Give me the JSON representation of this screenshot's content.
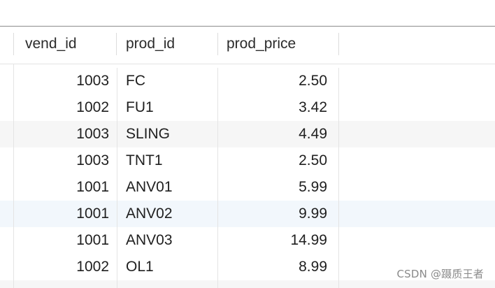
{
  "table": {
    "columns": [
      "vend_id",
      "prod_id",
      "prod_price"
    ],
    "rows": [
      {
        "vend_id": "1003",
        "prod_id": "FC",
        "prod_price": "2.50"
      },
      {
        "vend_id": "1002",
        "prod_id": "FU1",
        "prod_price": "3.42"
      },
      {
        "vend_id": "1003",
        "prod_id": "SLING",
        "prod_price": "4.49"
      },
      {
        "vend_id": "1003",
        "prod_id": "TNT1",
        "prod_price": "2.50"
      },
      {
        "vend_id": "1001",
        "prod_id": "ANV01",
        "prod_price": "5.99"
      },
      {
        "vend_id": "1001",
        "prod_id": "ANV02",
        "prod_price": "9.99"
      },
      {
        "vend_id": "1001",
        "prod_id": "ANV03",
        "prod_price": "14.99"
      },
      {
        "vend_id": "1002",
        "prod_id": "OL1",
        "prod_price": "8.99"
      }
    ]
  },
  "watermark": "CSDN @蹑质王者",
  "colors": {
    "header_text": "#2b2b2b",
    "cell_text": "#1f1f1f",
    "row_shade": "#f6f6f6",
    "row_selected_shade": "#f2f7fc",
    "grid_line": "#e4e4e4"
  }
}
